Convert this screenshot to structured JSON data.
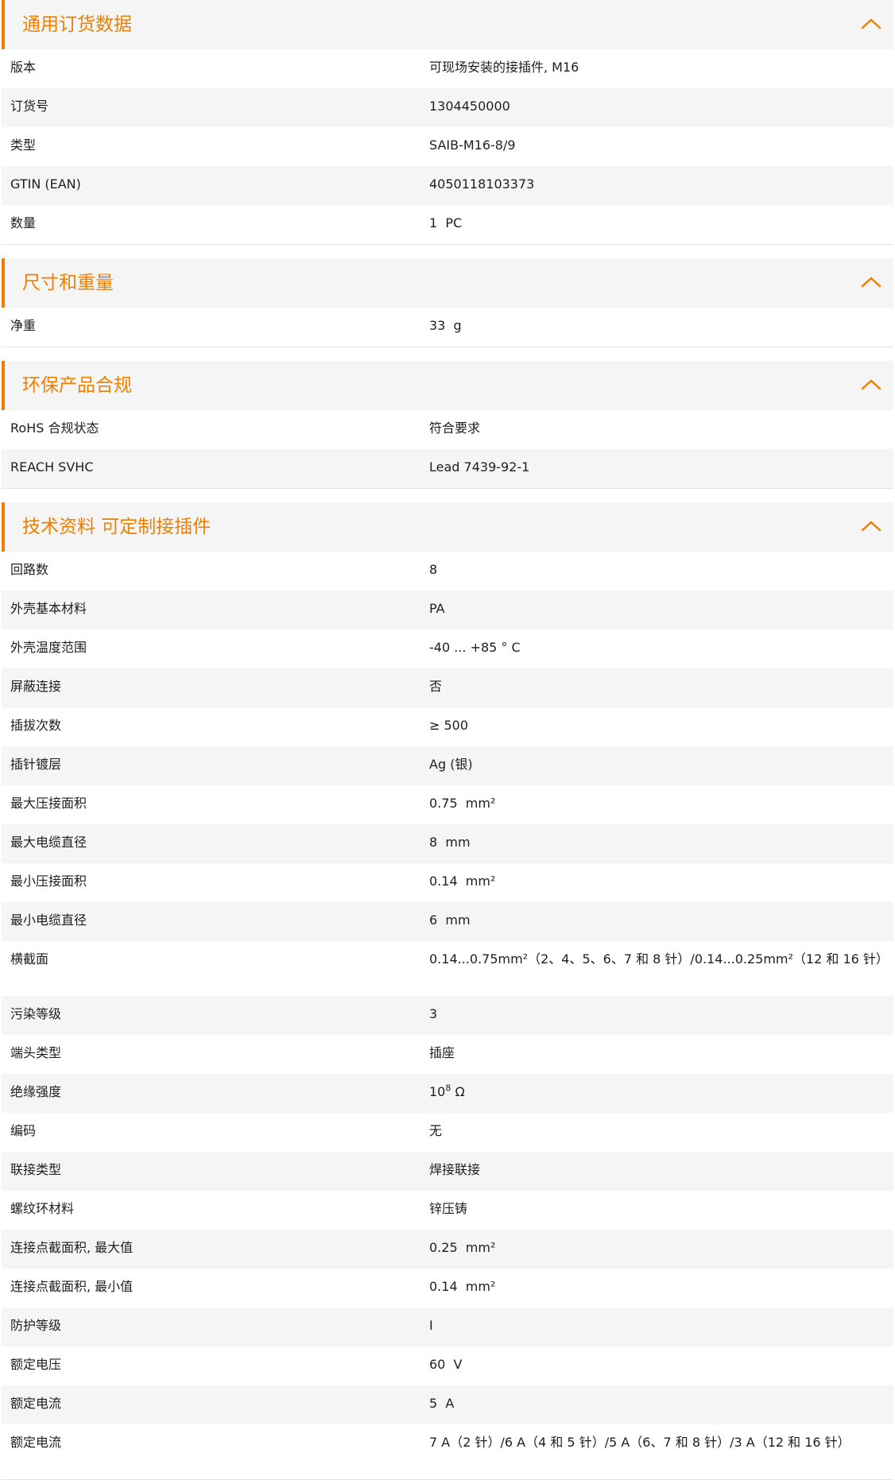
{
  "accent_color": "#ee7f00",
  "collapse_icon": "chevron-up-icon",
  "sections": [
    {
      "title": "通用订货数据",
      "rows": [
        {
          "label": "版本",
          "value": "可现场安装的接插件, M16"
        },
        {
          "label": "订货号",
          "value": "1304450000"
        },
        {
          "label": "类型",
          "value": "SAIB-M16-8/9"
        },
        {
          "label": "GTIN (EAN)",
          "value": "4050118103373"
        },
        {
          "label": "数量",
          "value": "1  PC"
        }
      ]
    },
    {
      "title": "尺寸和重量",
      "rows": [
        {
          "label": "净重",
          "value": "33  g"
        }
      ]
    },
    {
      "title": "环保产品合规",
      "rows": [
        {
          "label": "RoHS 合规状态",
          "value": "符合要求"
        },
        {
          "label": "REACH SVHC",
          "value": "Lead 7439-92-1"
        }
      ]
    },
    {
      "title": "技术资料 可定制接插件",
      "rows": [
        {
          "label": "回路数",
          "value": "8"
        },
        {
          "label": "外壳基本材料",
          "value": "PA"
        },
        {
          "label": "外壳温度范围",
          "value": "-40 ... +85 ° C"
        },
        {
          "label": "屏蔽连接",
          "value": "否"
        },
        {
          "label": "插拔次数",
          "value": "≥ 500"
        },
        {
          "label": "插针镀层",
          "value": "Ag (银)"
        },
        {
          "label": "最大压接面积",
          "value": "0.75  mm²"
        },
        {
          "label": "最大电缆直径",
          "value": "8  mm"
        },
        {
          "label": "最小压接面积",
          "value": "0.14  mm²"
        },
        {
          "label": "最小电缆直径",
          "value": "6  mm"
        },
        {
          "label": "横截面",
          "value": "0.14...0.75mm²（2、4、5、6、7 和 8 针）/0.14...0.25mm²（12 和 16 针）"
        },
        {
          "label": "污染等级",
          "value": "3"
        },
        {
          "label": "端头类型",
          "value": "插座"
        },
        {
          "label": "绝缘强度",
          "value": "10",
          "sup": "8",
          "suffix": " Ω"
        },
        {
          "label": "编码",
          "value": "无"
        },
        {
          "label": "联接类型",
          "value": "焊接联接"
        },
        {
          "label": "螺纹环材料",
          "value": "锌压铸"
        },
        {
          "label": "连接点截面积, 最大值",
          "value": "0.25  mm²"
        },
        {
          "label": "连接点截面积, 最小值",
          "value": "0.14  mm²"
        },
        {
          "label": "防护等级",
          "value": "I"
        },
        {
          "label": "额定电压",
          "value": "60  V"
        },
        {
          "label": "额定电流",
          "value": "5  A"
        },
        {
          "label": "额定电流",
          "value": "7 A（2 针）/6 A（4 和 5 针）/5 A（6、7 和 8 针）/3 A（12 和 16 针）"
        }
      ]
    }
  ]
}
